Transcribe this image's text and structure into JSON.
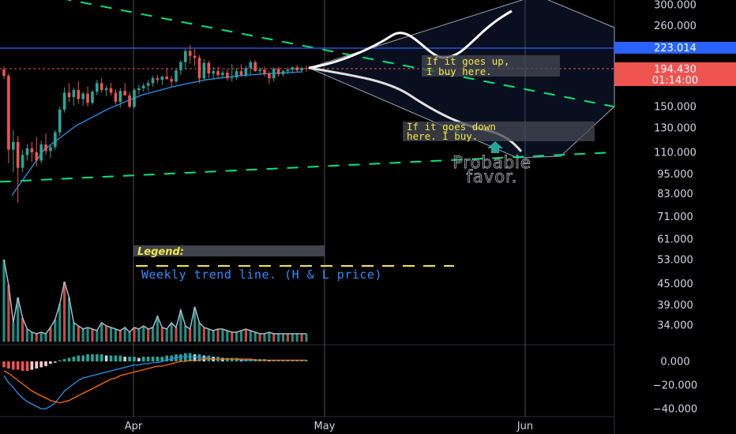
{
  "chart_data": [
    {
      "type": "candlestick",
      "scale": "log",
      "grid": false,
      "price_axis_labels": [
        "300.000",
        "260.000",
        "223.014",
        "194.430",
        "150.000",
        "130.000",
        "110.000",
        "95.000",
        "83.000",
        "71.000",
        "61.000",
        "53.000",
        "45.000",
        "39.000",
        "34.000"
      ],
      "current_price": "194.430",
      "countdown": "01:14:00",
      "level_price": "223.014",
      "time_labels": [
        "Apr",
        "May",
        "Jun"
      ],
      "colors": {
        "up": "#26a69a",
        "down": "#ef5350",
        "trend": "#2196f3",
        "channel": "#00e676",
        "level": "#2962ff"
      },
      "candles": [
        {
          "o": 193,
          "h": 197,
          "l": 181,
          "c": 185
        },
        {
          "o": 185,
          "h": 188,
          "l": 102,
          "c": 112
        },
        {
          "o": 112,
          "h": 128,
          "l": 96,
          "c": 118
        },
        {
          "o": 118,
          "h": 123,
          "l": 78,
          "c": 99
        },
        {
          "o": 99,
          "h": 112,
          "l": 96,
          "c": 108
        },
        {
          "o": 108,
          "h": 116,
          "l": 104,
          "c": 113
        },
        {
          "o": 113,
          "h": 118,
          "l": 103,
          "c": 110
        },
        {
          "o": 110,
          "h": 122,
          "l": 100,
          "c": 104
        },
        {
          "o": 104,
          "h": 119,
          "l": 102,
          "c": 116
        },
        {
          "o": 116,
          "h": 125,
          "l": 108,
          "c": 111
        },
        {
          "o": 111,
          "h": 116,
          "l": 106,
          "c": 114
        },
        {
          "o": 114,
          "h": 128,
          "l": 112,
          "c": 126
        },
        {
          "o": 126,
          "h": 150,
          "l": 123,
          "c": 147
        },
        {
          "o": 147,
          "h": 171,
          "l": 144,
          "c": 165
        },
        {
          "o": 165,
          "h": 176,
          "l": 155,
          "c": 160
        },
        {
          "o": 160,
          "h": 171,
          "l": 151,
          "c": 168
        },
        {
          "o": 168,
          "h": 178,
          "l": 153,
          "c": 158
        },
        {
          "o": 158,
          "h": 166,
          "l": 151,
          "c": 164
        },
        {
          "o": 164,
          "h": 172,
          "l": 150,
          "c": 154
        },
        {
          "o": 154,
          "h": 168,
          "l": 152,
          "c": 166
        },
        {
          "o": 166,
          "h": 180,
          "l": 162,
          "c": 176
        },
        {
          "o": 176,
          "h": 182,
          "l": 165,
          "c": 168
        },
        {
          "o": 168,
          "h": 173,
          "l": 161,
          "c": 170
        },
        {
          "o": 170,
          "h": 176,
          "l": 162,
          "c": 165
        },
        {
          "o": 165,
          "h": 169,
          "l": 152,
          "c": 155
        },
        {
          "o": 155,
          "h": 170,
          "l": 149,
          "c": 167
        },
        {
          "o": 167,
          "h": 176,
          "l": 162,
          "c": 162
        },
        {
          "o": 162,
          "h": 166,
          "l": 148,
          "c": 150
        },
        {
          "o": 150,
          "h": 170,
          "l": 148,
          "c": 168
        },
        {
          "o": 168,
          "h": 174,
          "l": 163,
          "c": 170
        },
        {
          "o": 170,
          "h": 176,
          "l": 166,
          "c": 173
        },
        {
          "o": 173,
          "h": 180,
          "l": 166,
          "c": 176
        },
        {
          "o": 176,
          "h": 185,
          "l": 172,
          "c": 182
        },
        {
          "o": 182,
          "h": 186,
          "l": 176,
          "c": 180
        },
        {
          "o": 180,
          "h": 185,
          "l": 174,
          "c": 184
        },
        {
          "o": 184,
          "h": 195,
          "l": 180,
          "c": 181
        },
        {
          "o": 181,
          "h": 185,
          "l": 172,
          "c": 178
        },
        {
          "o": 178,
          "h": 195,
          "l": 176,
          "c": 192
        },
        {
          "o": 192,
          "h": 206,
          "l": 186,
          "c": 203
        },
        {
          "o": 203,
          "h": 222,
          "l": 193,
          "c": 219
        },
        {
          "o": 219,
          "h": 228,
          "l": 201,
          "c": 212
        },
        {
          "o": 212,
          "h": 222,
          "l": 198,
          "c": 209
        },
        {
          "o": 209,
          "h": 213,
          "l": 176,
          "c": 182
        },
        {
          "o": 182,
          "h": 207,
          "l": 179,
          "c": 202
        },
        {
          "o": 202,
          "h": 205,
          "l": 182,
          "c": 188
        },
        {
          "o": 188,
          "h": 196,
          "l": 181,
          "c": 191
        },
        {
          "o": 191,
          "h": 197,
          "l": 182,
          "c": 186
        },
        {
          "o": 186,
          "h": 192,
          "l": 182,
          "c": 189
        },
        {
          "o": 189,
          "h": 193,
          "l": 179,
          "c": 182
        },
        {
          "o": 182,
          "h": 200,
          "l": 178,
          "c": 183
        },
        {
          "o": 183,
          "h": 195,
          "l": 180,
          "c": 191
        },
        {
          "o": 191,
          "h": 200,
          "l": 184,
          "c": 186
        },
        {
          "o": 186,
          "h": 198,
          "l": 183,
          "c": 195
        },
        {
          "o": 195,
          "h": 206,
          "l": 187,
          "c": 203
        },
        {
          "o": 203,
          "h": 206,
          "l": 190,
          "c": 191
        },
        {
          "o": 191,
          "h": 196,
          "l": 186,
          "c": 193
        },
        {
          "o": 193,
          "h": 197,
          "l": 184,
          "c": 188
        },
        {
          "o": 188,
          "h": 191,
          "l": 175,
          "c": 182
        },
        {
          "o": 182,
          "h": 196,
          "l": 178,
          "c": 194
        },
        {
          "o": 194,
          "h": 197,
          "l": 184,
          "c": 187
        },
        {
          "o": 187,
          "h": 193,
          "l": 184,
          "c": 191
        },
        {
          "o": 191,
          "h": 196,
          "l": 187,
          "c": 193
        },
        {
          "o": 193,
          "h": 197,
          "l": 188,
          "c": 196
        },
        {
          "o": 196,
          "h": 199,
          "l": 190,
          "c": 192
        },
        {
          "o": 192,
          "h": 197,
          "l": 189,
          "c": 195
        },
        {
          "o": 195,
          "h": 198,
          "l": 190,
          "c": 194
        }
      ],
      "weekly_trend_line": [
        82,
        112,
        132,
        148,
        162,
        172,
        180,
        185,
        188,
        190
      ],
      "channel_upper": [
        {
          "t": 0,
          "p": 340
        },
        {
          "t": 1,
          "p": 150
        }
      ],
      "channel_lower": [
        {
          "t": 0,
          "p": 90
        },
        {
          "t": 1,
          "p": 110
        }
      ]
    },
    {
      "type": "line",
      "panel": "volume-oscillator",
      "values": [
        52,
        36,
        12,
        28,
        15,
        8,
        6,
        5,
        6,
        5,
        9,
        14,
        24,
        38,
        28,
        12,
        10,
        8,
        9,
        8,
        7,
        12,
        10,
        9,
        8,
        7,
        9,
        6,
        9,
        8,
        10,
        8,
        9,
        16,
        9,
        8,
        12,
        9,
        20,
        10,
        8,
        22,
        12,
        9,
        8,
        7,
        8,
        8,
        7,
        6,
        6,
        7,
        8,
        7,
        6,
        5,
        5,
        6,
        5,
        5,
        5,
        5,
        5,
        5,
        5,
        5
      ]
    },
    {
      "type": "bar",
      "panel": "macd",
      "tick_labels": [
        "0.000",
        "−20.000",
        "−40.000"
      ],
      "ylim": [
        -48,
        10
      ],
      "histogram": [
        -5,
        -6,
        -7,
        -7,
        -8,
        -8,
        -7,
        -6,
        -5,
        -4,
        -2,
        -1,
        1,
        2,
        3,
        4,
        5,
        5,
        6,
        6,
        6,
        6,
        5,
        5,
        5,
        5,
        4,
        4,
        4,
        3,
        4,
        4,
        4,
        4,
        4,
        5,
        5,
        6,
        6,
        7,
        7,
        6,
        6,
        5,
        5,
        4,
        4,
        3,
        3,
        3,
        3,
        2,
        2,
        2,
        2,
        2,
        2,
        1,
        1,
        1,
        1,
        1,
        1,
        1,
        1,
        1
      ],
      "macd_line": [
        -12,
        -18,
        -22,
        -27,
        -31,
        -34,
        -36,
        -38,
        -40,
        -40,
        -38,
        -35,
        -30,
        -25,
        -22,
        -19,
        -16,
        -14,
        -13,
        -12,
        -11,
        -10,
        -9,
        -8,
        -7,
        -6,
        -5,
        -4,
        -3,
        -3,
        -2,
        -2,
        -1,
        -1,
        0,
        1,
        2,
        3,
        4,
        4,
        4,
        4,
        3,
        3,
        3,
        2,
        2,
        2,
        2,
        2,
        2,
        1,
        1,
        1,
        1,
        1,
        1,
        1,
        1,
        1,
        1,
        1,
        1,
        1,
        1,
        1
      ],
      "signal_line": [
        -8,
        -10,
        -13,
        -16,
        -19,
        -22,
        -25,
        -27,
        -29,
        -31,
        -33,
        -34,
        -35,
        -34,
        -33,
        -31,
        -29,
        -27,
        -25,
        -23,
        -21,
        -19,
        -17,
        -15,
        -14,
        -12,
        -11,
        -10,
        -9,
        -8,
        -7,
        -6,
        -5,
        -4,
        -4,
        -3,
        -2,
        -1,
        0,
        0,
        1,
        1,
        1,
        2,
        2,
        2,
        2,
        2,
        2,
        2,
        2,
        2,
        2,
        2,
        1,
        1,
        1,
        1,
        1,
        1,
        1,
        1,
        1,
        1,
        1,
        1
      ]
    }
  ],
  "annotations": {
    "up_note": [
      "If it goes up,",
      "I buy here."
    ],
    "down_note": [
      "If it goes down",
      "here. I buy."
    ],
    "favor_text": [
      "Probable",
      "favor."
    ],
    "legend_title": "Legend:",
    "legend_line": "Weekly trend line. (H & L price)"
  }
}
